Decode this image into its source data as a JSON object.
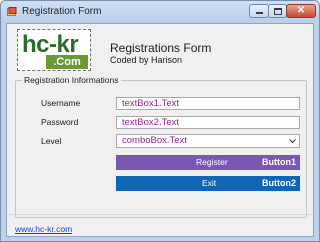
{
  "window": {
    "title": "Registration Form"
  },
  "header": {
    "logo": {
      "main_left": "hc",
      "main_dash": "-",
      "main_right": "kr",
      "sub": ".Com"
    },
    "title": "Registrations Form",
    "subtitle": "Coded by Harison"
  },
  "group": {
    "legend": "Registration Informations"
  },
  "fields": {
    "username": {
      "label": "Username",
      "value": "textBox1.Text"
    },
    "password": {
      "label": "Password",
      "value": "textBox2.Text"
    },
    "level": {
      "label": "Level",
      "value": "comboBox.Text"
    }
  },
  "buttons": {
    "register": {
      "label": "Register",
      "name": "Button1",
      "color": "#7b56b2"
    },
    "exit": {
      "label": "Exit",
      "name": "Button2",
      "color": "#0f65b6"
    }
  },
  "footer": {
    "link": "www.hc-kr.com"
  },
  "colors": {
    "titlebar": "#bcd1ea",
    "client": "#f0f0f0",
    "field_text": "#8a2a8c",
    "logo_green": "#2d6b2c",
    "logo_badge": "#6a9a36",
    "link": "#1c3fcf",
    "close_button": "#c8462c"
  },
  "icons": {
    "app": "form-app-icon",
    "minimize": "minimize-icon",
    "maximize": "maximize-icon",
    "close": "close-icon",
    "dropdown": "chevron-down-icon"
  }
}
